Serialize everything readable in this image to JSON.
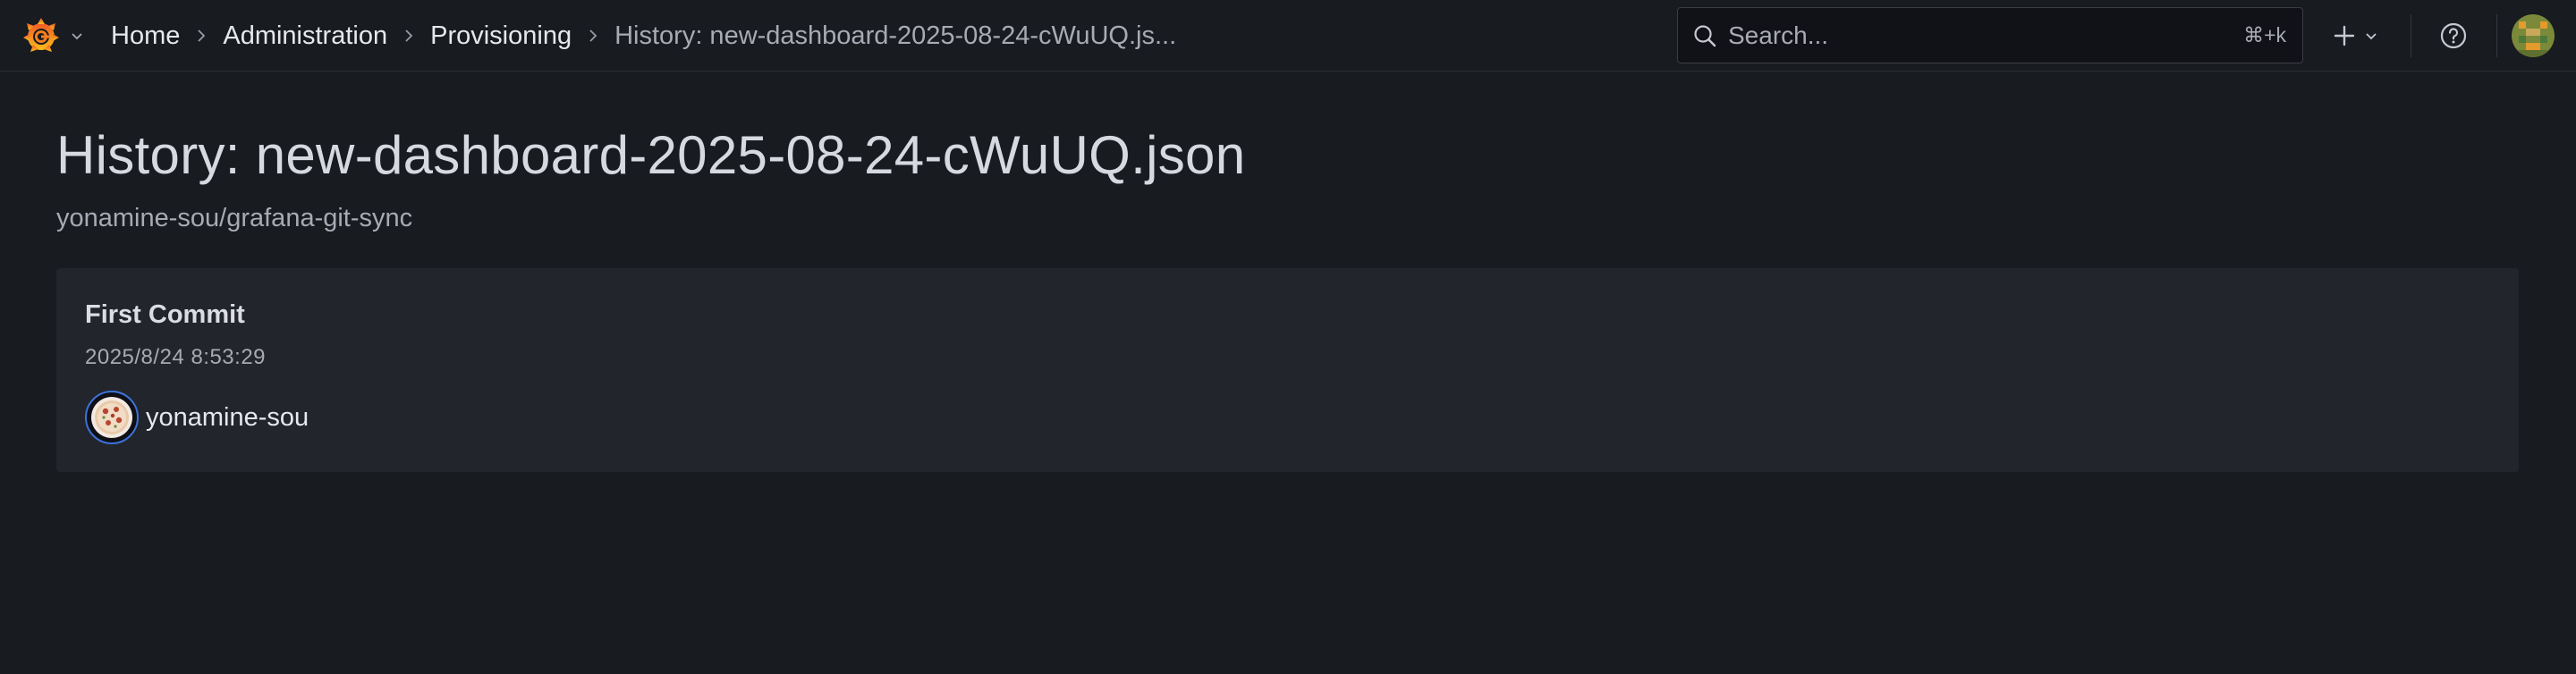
{
  "topbar": {
    "logo_icon": "grafana-logo-icon",
    "breadcrumb": [
      {
        "label": "Home"
      },
      {
        "label": "Administration"
      },
      {
        "label": "Provisioning"
      }
    ],
    "breadcrumb_current": "History: new-dashboard-2025-08-24-cWuUQ.js...",
    "search": {
      "placeholder": "Search...",
      "shortcut": "⌘+k"
    },
    "add_icon": "plus-icon",
    "help_icon": "help-icon"
  },
  "page": {
    "title": "History: new-dashboard-2025-08-24-cWuUQ.json",
    "subtitle": "yonamine-sou/grafana-git-sync"
  },
  "commits": [
    {
      "title": "First Commit",
      "date": "2025/8/24 8:53:29",
      "author": "yonamine-sou"
    }
  ],
  "colors": {
    "background": "#181b1f",
    "card": "#22252b",
    "text_primary": "#d8d9e0",
    "text_secondary": "#a8aab4",
    "avatar_ring": "#3d71d9",
    "logo_orange": "#f46800",
    "logo_yellow": "#fbbe1c"
  }
}
